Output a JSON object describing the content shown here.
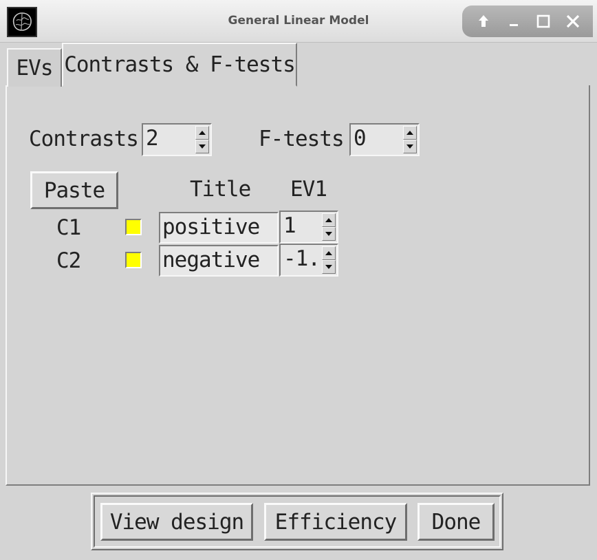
{
  "window": {
    "title": "General Linear Model",
    "icon": "fsl-brain-icon",
    "controls": [
      "up-arrow-icon",
      "minimize-icon",
      "maximize-icon",
      "close-icon"
    ]
  },
  "tabs": [
    {
      "label": "EVs",
      "active": false
    },
    {
      "label": "Contrasts & F-tests",
      "active": true
    }
  ],
  "setup": {
    "contrasts_label": "Contrasts",
    "contrasts_value": "2",
    "ftests_label": "F-tests",
    "ftests_value": "0"
  },
  "table": {
    "paste_label": "Paste",
    "title_header": "Title",
    "ev_header": "EV1",
    "rows": [
      {
        "name": "C1",
        "checked": true,
        "title": "positive",
        "ev1": "1"
      },
      {
        "name": "C2",
        "checked": true,
        "title": "negative",
        "ev1": "-1."
      }
    ]
  },
  "footer": {
    "view_design_label": "View design",
    "efficiency_label": "Efficiency",
    "done_label": "Done"
  },
  "colors": {
    "background": "#d4d4d4",
    "checkbox": "#ffff00"
  }
}
